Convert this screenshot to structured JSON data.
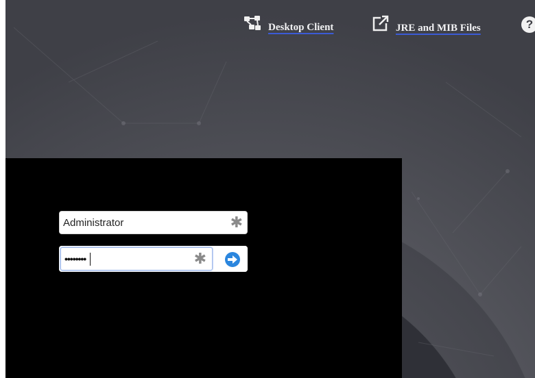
{
  "topbar": {
    "desktop_client_label": "Desktop Client",
    "desktop_client_icon": "network-nodes-icon",
    "jre_mib_label": "JRE and MIB Files",
    "jre_mib_icon": "external-link-icon",
    "help_icon": "help-icon",
    "help_glyph": "?"
  },
  "login": {
    "username_value": "Administrator",
    "username_required_mark": "✱",
    "password_masked": "••••••••",
    "password_required_mark": "✱",
    "submit_icon": "arrow-right-circle-icon"
  },
  "colors": {
    "background": "#3d3e45",
    "panel": "#000000",
    "link_underline": "#3b5bd6",
    "submit_button": "#2b86de"
  }
}
